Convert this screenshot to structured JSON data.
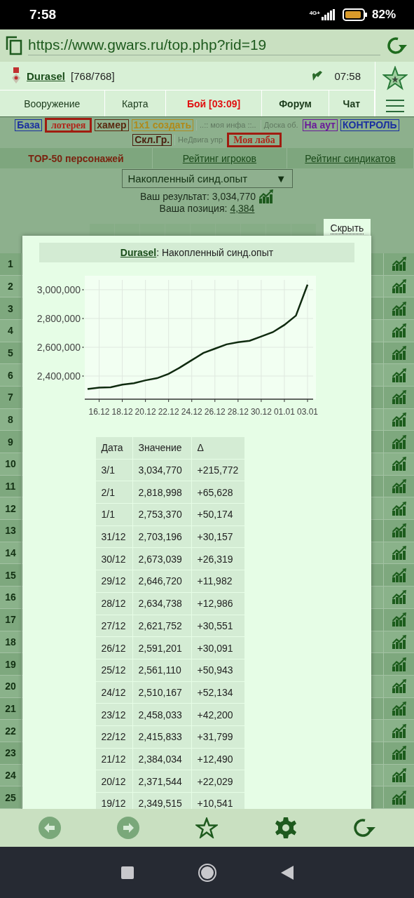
{
  "status_bar": {
    "time": "7:58",
    "network": "4G+",
    "battery": "82%"
  },
  "address_bar": {
    "url": "https://www.gwars.ru/top.php?rid=19"
  },
  "user_bar": {
    "name": "Durasel",
    "hp": "[768/768]",
    "time": "07:58"
  },
  "nav": [
    {
      "label": "Вооружение",
      "kind": "normal"
    },
    {
      "label": "Карта",
      "kind": "normal"
    },
    {
      "label": "Бой [03:09]",
      "kind": "alert"
    },
    {
      "label": "Форум",
      "kind": "bold"
    },
    {
      "label": "Чат",
      "kind": "bold"
    }
  ],
  "quick_links": [
    {
      "label": "База",
      "kind": "boxed",
      "color": "#1a2fa0"
    },
    {
      "label": "лотерея",
      "kind": "thick",
      "color": "#b0261a"
    },
    {
      "label": "хамер",
      "kind": "boxed",
      "color": "#5a2a10"
    },
    {
      "label": "1x1 создать",
      "kind": "boxed",
      "color": "#b08a1a"
    },
    {
      "label": "..:: моя инфа ::..",
      "kind": "plain",
      "color": "#607860"
    },
    {
      "label": "Доска об.",
      "kind": "plain",
      "color": "#607860"
    },
    {
      "label": "На аут",
      "kind": "boxed",
      "color": "#6a1a9a"
    },
    {
      "label": "КОНТРОЛЬ",
      "kind": "boxed",
      "color": "#1a2fa0"
    },
    {
      "label": "Скл.Гр.",
      "kind": "boxed",
      "color": "#4a2010"
    },
    {
      "label": "НеДвига упр",
      "kind": "plain",
      "color": "#607860"
    },
    {
      "label": "Моя лаба",
      "kind": "thick",
      "color": "#b0261a"
    }
  ],
  "tabs": [
    {
      "label": "TOP-50 персонажей",
      "selected": true
    },
    {
      "label": "Рейтинг игроков",
      "selected": false
    },
    {
      "label": "Рейтинг синдикатов",
      "selected": false
    }
  ],
  "selector": {
    "value": "Накопленный синд.опыт",
    "arrow": "▼"
  },
  "result": {
    "label": "Ваш результат:",
    "value": "3,034,770"
  },
  "position": {
    "label": "Ваша позиция:",
    "value": "4,384"
  },
  "hide_button": "Скрыть",
  "ranking_rows": [
    {
      "rank": "1"
    },
    {
      "rank": "2"
    },
    {
      "rank": "3"
    },
    {
      "rank": "4"
    },
    {
      "rank": "5"
    },
    {
      "rank": "6"
    },
    {
      "rank": "7"
    },
    {
      "rank": "8"
    },
    {
      "rank": "9"
    },
    {
      "rank": "10"
    },
    {
      "rank": "11"
    },
    {
      "rank": "12"
    },
    {
      "rank": "13"
    },
    {
      "rank": "14"
    },
    {
      "rank": "15"
    },
    {
      "rank": "16"
    },
    {
      "rank": "17"
    },
    {
      "rank": "18"
    },
    {
      "rank": "19"
    },
    {
      "rank": "20"
    },
    {
      "rank": "21"
    },
    {
      "rank": "22"
    },
    {
      "rank": "23"
    },
    {
      "rank": "24"
    },
    {
      "rank": "25"
    }
  ],
  "popup": {
    "player": "Durasel",
    "title": ": Накопленный синд.опыт",
    "chart_data": {
      "type": "line",
      "categories": [
        null,
        "16.12",
        null,
        "18.12",
        null,
        "20.12",
        null,
        "22.12",
        null,
        "24.12",
        null,
        "26.12",
        null,
        "28.12",
        null,
        "30.12",
        null,
        "01.01",
        null,
        "03.01"
      ],
      "series": [
        {
          "color": "#0f2a0f",
          "values": [
            2310000,
            2320000,
            2322000,
            2340000,
            2350000,
            2370000,
            2385000,
            2415000,
            2460000,
            2510000,
            2560000,
            2590000,
            2620000,
            2635000,
            2645000,
            2675000,
            2705000,
            2755000,
            2820000,
            3035000
          ]
        }
      ],
      "ylim": [
        2239000,
        3068000
      ],
      "grid": true,
      "yticks": [
        {
          "value": 2400000,
          "label": "2,400,000"
        },
        {
          "value": 2600000,
          "label": "2,600,000"
        },
        {
          "value": 2800000,
          "label": "2,800,000"
        },
        {
          "value": 3000000,
          "label": "3,000,000"
        }
      ]
    },
    "history": {
      "columns": [
        "Дата",
        "Значение",
        "Δ"
      ],
      "rows": [
        [
          "3/1",
          "3,034,770",
          "+215,772"
        ],
        [
          "2/1",
          "2,818,998",
          "+65,628"
        ],
        [
          "1/1",
          "2,753,370",
          "+50,174"
        ],
        [
          "31/12",
          "2,703,196",
          "+30,157"
        ],
        [
          "30/12",
          "2,673,039",
          "+26,319"
        ],
        [
          "29/12",
          "2,646,720",
          "+11,982"
        ],
        [
          "28/12",
          "2,634,738",
          "+12,986"
        ],
        [
          "27/12",
          "2,621,752",
          "+30,551"
        ],
        [
          "26/12",
          "2,591,201",
          "+30,091"
        ],
        [
          "25/12",
          "2,561,110",
          "+50,943"
        ],
        [
          "24/12",
          "2,510,167",
          "+52,134"
        ],
        [
          "23/12",
          "2,458,033",
          "+42,200"
        ],
        [
          "22/12",
          "2,415,833",
          "+31,799"
        ],
        [
          "21/12",
          "2,384,034",
          "+12,490"
        ],
        [
          "20/12",
          "2,371,544",
          "+22,029"
        ],
        [
          "19/12",
          "2,349,515",
          "+10,541"
        ]
      ]
    }
  }
}
